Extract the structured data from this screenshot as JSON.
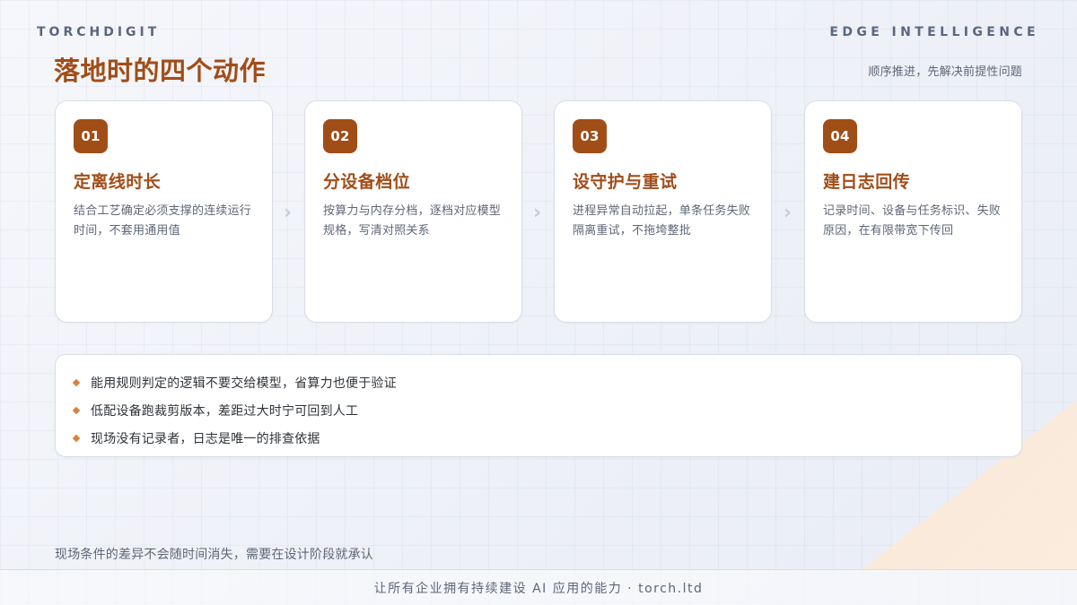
{
  "header": {
    "brand": "TORCHDIGIT",
    "section": "EDGE INTELLIGENCE",
    "title": "落地时的四个动作",
    "subtitle": "顺序推进，先解决前提性问题"
  },
  "steps": [
    {
      "number": "01",
      "title": "定离线时长",
      "description": "结合工艺确定必须支撑的连续运行时间，不套用通用值"
    },
    {
      "number": "02",
      "title": "分设备档位",
      "description": "按算力与内存分档，逐档对应模型规格，写清对照关系"
    },
    {
      "number": "03",
      "title": "设守护与重试",
      "description": "进程异常自动拉起，单条任务失败隔离重试，不拖垮整批"
    },
    {
      "number": "04",
      "title": "建日志回传",
      "description": "记录时间、设备与任务标识、失败原因，在有限带宽下传回"
    }
  ],
  "arrows": {
    "glyph": "›"
  },
  "notes": [
    "能用规则判定的逻辑不要交给模型，省算力也便于验证",
    "低配设备跑裁剪版本，差距过大时宁可回到人工",
    "现场没有记录者，日志是唯一的排查依据"
  ],
  "footer": {
    "note": "现场条件的差异不会随时间消失，需要在设计阶段就承认",
    "tagline": "让所有企业拥有持续建设 AI 应用的能力 · torch.ltd"
  },
  "colors": {
    "accent": "#a14d18",
    "bullet": "#dd7f38",
    "muted_text": "#5e6777",
    "card_border": "#d8dde8",
    "background": "#eef1f7"
  }
}
